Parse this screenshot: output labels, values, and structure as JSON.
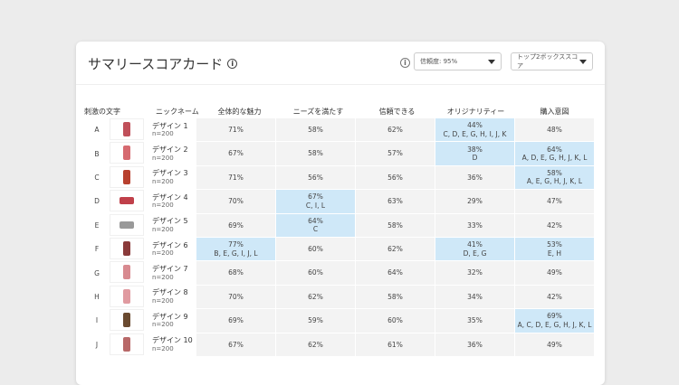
{
  "header": {
    "title": "サマリースコアカード",
    "confidence": "信頼度: 95%",
    "metric": "トップ2ボックススコア"
  },
  "columns": [
    "刺激の文字",
    "ニックネーム",
    "全体的な魅力",
    "ニーズを満たす",
    "信頼できる",
    "オリジナリティー",
    "購入意図"
  ],
  "colors": {
    "highlight": "#cfe8f8",
    "cell": "#f3f3f3"
  },
  "rows": [
    {
      "letter": "A",
      "name": "デザイン 1",
      "n": "n=200",
      "thumb": "#c0505a",
      "cells": [
        {
          "v": "71%"
        },
        {
          "v": "58%"
        },
        {
          "v": "62%"
        },
        {
          "v": "44%",
          "sig": "C, D, E, G, H, I, J, K"
        },
        {
          "v": "48%"
        }
      ]
    },
    {
      "letter": "B",
      "name": "デザイン 2",
      "n": "n=200",
      "thumb": "#d66a70",
      "cells": [
        {
          "v": "67%"
        },
        {
          "v": "58%"
        },
        {
          "v": "57%"
        },
        {
          "v": "38%",
          "sig": "D"
        },
        {
          "v": "64%",
          "sig": "A, D, E, G, H, J, K, L"
        }
      ]
    },
    {
      "letter": "C",
      "name": "デザイン 3",
      "n": "n=200",
      "thumb": "#b8402e",
      "cells": [
        {
          "v": "71%"
        },
        {
          "v": "56%"
        },
        {
          "v": "56%"
        },
        {
          "v": "36%"
        },
        {
          "v": "58%",
          "sig": "A, E, G, H, J, K, L"
        }
      ]
    },
    {
      "letter": "D",
      "name": "デザイン 4",
      "n": "n=200",
      "thumb": "#c0404a",
      "cells": [
        {
          "v": "70%"
        },
        {
          "v": "67%",
          "sig": "C, I, L"
        },
        {
          "v": "63%"
        },
        {
          "v": "29%"
        },
        {
          "v": "47%"
        }
      ]
    },
    {
      "letter": "E",
      "name": "デザイン 5",
      "n": "n=200",
      "thumb": "#999999",
      "cells": [
        {
          "v": "69%"
        },
        {
          "v": "64%",
          "sig": "C"
        },
        {
          "v": "58%"
        },
        {
          "v": "33%"
        },
        {
          "v": "42%"
        }
      ]
    },
    {
      "letter": "F",
      "name": "デザイン 6",
      "n": "n=200",
      "thumb": "#8a3a3a",
      "cells": [
        {
          "v": "77%",
          "sig": "B, E, G, I, J, L"
        },
        {
          "v": "60%"
        },
        {
          "v": "62%"
        },
        {
          "v": "41%",
          "sig": "D, E, G"
        },
        {
          "v": "53%",
          "sig": "E, H"
        }
      ]
    },
    {
      "letter": "G",
      "name": "デザイン 7",
      "n": "n=200",
      "thumb": "#d88a90",
      "cells": [
        {
          "v": "68%"
        },
        {
          "v": "60%"
        },
        {
          "v": "64%"
        },
        {
          "v": "32%"
        },
        {
          "v": "49%"
        }
      ]
    },
    {
      "letter": "H",
      "name": "デザイン 8",
      "n": "n=200",
      "thumb": "#e09aa0",
      "cells": [
        {
          "v": "70%"
        },
        {
          "v": "62%"
        },
        {
          "v": "58%"
        },
        {
          "v": "34%"
        },
        {
          "v": "42%"
        }
      ]
    },
    {
      "letter": "I",
      "name": "デザイン 9",
      "n": "n=200",
      "thumb": "#6a4a30",
      "cells": [
        {
          "v": "69%"
        },
        {
          "v": "59%"
        },
        {
          "v": "60%"
        },
        {
          "v": "35%"
        },
        {
          "v": "69%",
          "sig": "A, C, D, E, G, H, J, K, L"
        }
      ]
    },
    {
      "letter": "J",
      "name": "デザイン 10",
      "n": "n=200",
      "thumb": "#b86868",
      "cells": [
        {
          "v": "67%"
        },
        {
          "v": "62%"
        },
        {
          "v": "61%"
        },
        {
          "v": "36%"
        },
        {
          "v": "49%"
        }
      ]
    }
  ]
}
